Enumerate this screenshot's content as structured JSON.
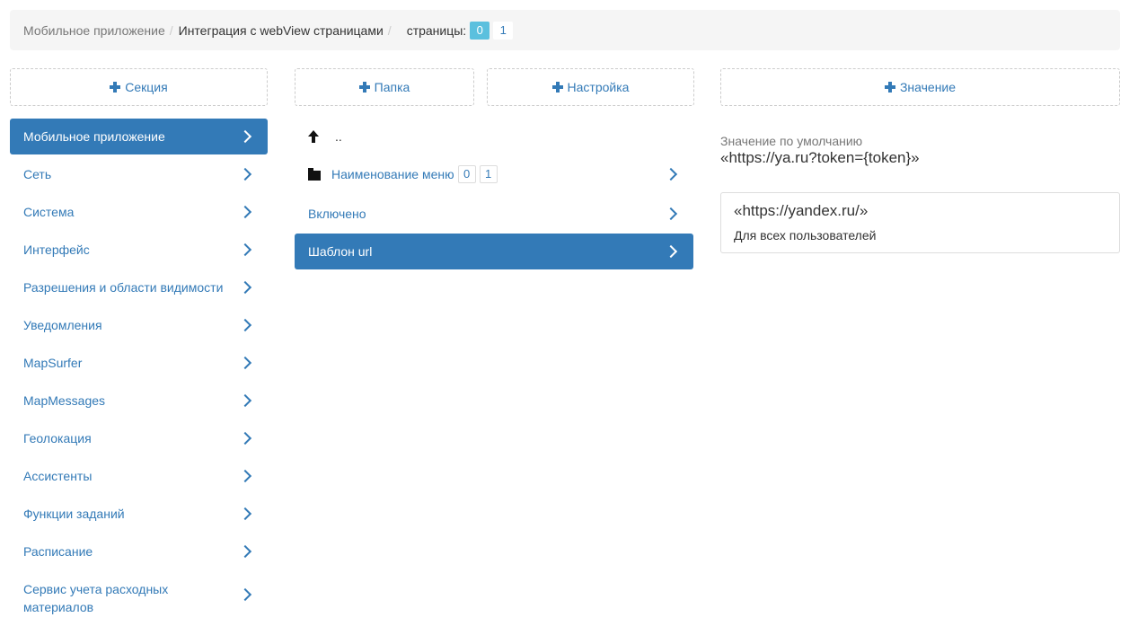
{
  "breadcrumb": {
    "items": [
      "Мобильное приложение",
      "Интеграция с webView страницами"
    ],
    "separator": "/",
    "pages_label": "страницы:",
    "pages": [
      "0",
      "1"
    ],
    "active_page": "0"
  },
  "sections": {
    "add_label": "Секция",
    "items": [
      {
        "label": "Мобильное приложение",
        "active": true
      },
      {
        "label": "Сеть"
      },
      {
        "label": "Система"
      },
      {
        "label": "Интерфейс"
      },
      {
        "label": "Разрешения и области видимости"
      },
      {
        "label": "Уведомления"
      },
      {
        "label": "MapSurfer"
      },
      {
        "label": "MapMessages"
      },
      {
        "label": "Геолокация"
      },
      {
        "label": "Ассистенты"
      },
      {
        "label": "Функции заданий"
      },
      {
        "label": "Расписание"
      },
      {
        "label": "Сервис учета расходных материалов"
      }
    ]
  },
  "middle": {
    "add_folder_label": "Папка",
    "add_setting_label": "Настройка",
    "up_label": "..",
    "folder": {
      "label": "Наименование меню",
      "pages": [
        "0",
        "1"
      ]
    },
    "settings": [
      {
        "label": "Включено"
      },
      {
        "label": "Шаблон url",
        "active": true
      }
    ]
  },
  "values": {
    "add_label": "Значение",
    "default_label": "Значение по умолчанию",
    "default_value": "«https://ya.ru?token={token}»",
    "items": [
      {
        "value": "«https://yandex.ru/»",
        "scope": "Для всех пользователей"
      }
    ]
  },
  "colors": {
    "accent": "#337ab7",
    "badge_active": "#5bc0de",
    "breadcrumb_bg": "#f5f5f5"
  }
}
